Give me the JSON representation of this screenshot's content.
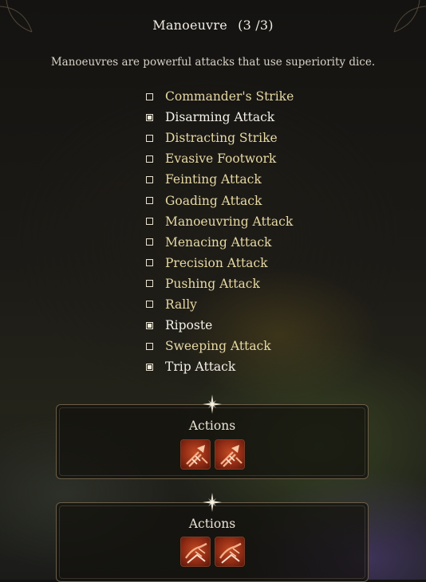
{
  "header": {
    "title": "Manoeuvre",
    "count": "(3 /3)",
    "description": "Manoeuvres are powerful attacks that use superiority dice."
  },
  "manoeuvres": [
    {
      "label": "Commander's Strike",
      "checked": false
    },
    {
      "label": "Disarming Attack",
      "checked": true
    },
    {
      "label": "Distracting Strike",
      "checked": false
    },
    {
      "label": "Evasive Footwork",
      "checked": false
    },
    {
      "label": "Feinting Attack",
      "checked": false
    },
    {
      "label": "Goading Attack",
      "checked": false
    },
    {
      "label": "Manoeuvring Attack",
      "checked": false
    },
    {
      "label": "Menacing Attack",
      "checked": false
    },
    {
      "label": "Precision Attack",
      "checked": false
    },
    {
      "label": "Pushing Attack",
      "checked": false
    },
    {
      "label": "Rally",
      "checked": false
    },
    {
      "label": "Riposte",
      "checked": true
    },
    {
      "label": "Sweeping Attack",
      "checked": false
    },
    {
      "label": "Trip Attack",
      "checked": true
    }
  ],
  "panels": [
    {
      "title": "Actions",
      "icons": [
        "disarming-attack-icon",
        "disarming-attack-icon"
      ]
    },
    {
      "title": "Actions",
      "icons": [
        "trip-attack-icon",
        "trip-attack-icon"
      ]
    }
  ],
  "colors": {
    "unselected_text": "#e7d9a4",
    "selected_text": "#f4f1ea",
    "action_icon": "#c14a22",
    "panel_border": "#6b5d48"
  }
}
